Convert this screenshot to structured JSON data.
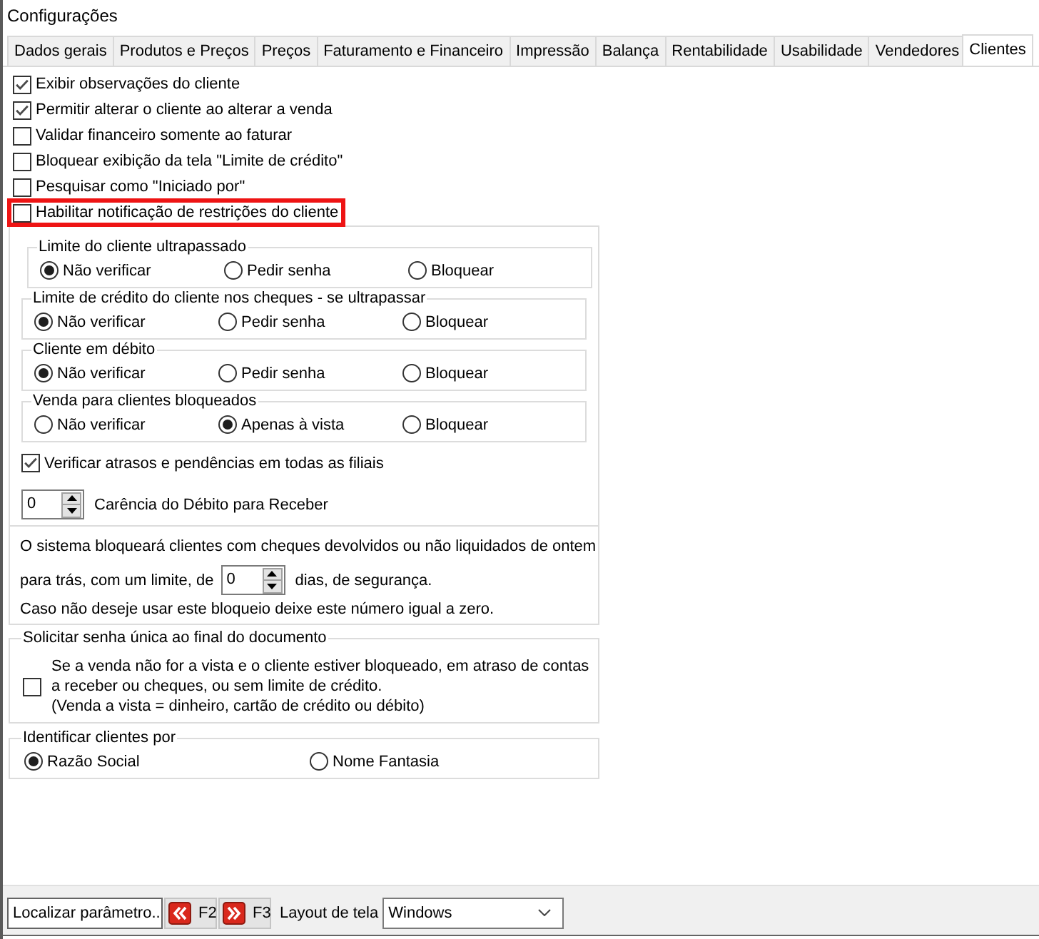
{
  "window": {
    "title": "Configurações"
  },
  "tabs": [
    {
      "label": "Dados gerais",
      "selected": false
    },
    {
      "label": "Produtos e Preços",
      "selected": false
    },
    {
      "label": "Preços",
      "selected": false
    },
    {
      "label": "Faturamento e Financeiro",
      "selected": false
    },
    {
      "label": "Impressão",
      "selected": false
    },
    {
      "label": "Balança",
      "selected": false
    },
    {
      "label": "Rentabilidade",
      "selected": false
    },
    {
      "label": "Usabilidade",
      "selected": false
    },
    {
      "label": "Vendedores",
      "selected": false
    },
    {
      "label": "Clientes",
      "selected": true
    }
  ],
  "options": [
    {
      "label": "Exibir observações do cliente",
      "checked": true,
      "highlighted": false
    },
    {
      "label": "Permitir alterar o cliente ao alterar a venda",
      "checked": true,
      "highlighted": false
    },
    {
      "label": "Validar financeiro somente ao faturar",
      "checked": false,
      "highlighted": false
    },
    {
      "label": "Bloquear exibição da tela \"Limite de crédito\"",
      "checked": false,
      "highlighted": false
    },
    {
      "label": "Pesquisar como \"Iniciado por\"",
      "checked": false,
      "highlighted": false
    },
    {
      "label": "Habilitar notificação de restrições do cliente",
      "checked": false,
      "highlighted": true
    }
  ],
  "restriction_groups": [
    {
      "title": "Limite do cliente ultrapassado",
      "choices": [
        {
          "label": "Não verificar",
          "selected": true
        },
        {
          "label": "Pedir senha",
          "selected": false
        },
        {
          "label": "Bloquear",
          "selected": false
        }
      ]
    },
    {
      "title": "Limite de crédito do cliente nos cheques - se ultrapassar",
      "choices": [
        {
          "label": "Não verificar",
          "selected": true
        },
        {
          "label": "Pedir senha",
          "selected": false
        },
        {
          "label": "Bloquear",
          "selected": false
        }
      ]
    },
    {
      "title": "Cliente em débito",
      "choices": [
        {
          "label": "Não verificar",
          "selected": true
        },
        {
          "label": "Pedir senha",
          "selected": false
        },
        {
          "label": "Bloquear",
          "selected": false
        }
      ]
    },
    {
      "title": "Venda para clientes bloqueados",
      "choices": [
        {
          "label": "Não verificar",
          "selected": false
        },
        {
          "label": "Apenas à vista",
          "selected": true
        },
        {
          "label": "Bloquear",
          "selected": false
        }
      ]
    }
  ],
  "check_all_branches": {
    "label": "Verificar atrasos e pendências em todas as filiais",
    "checked": true
  },
  "grace_period": {
    "value": "0",
    "label": "Carência do Débito para Receber"
  },
  "returned_cheques": {
    "line_1": "O sistema bloqueará clientes com cheques devolvidos ou não liquidados de ontem",
    "before_field": "para trás, com um limite, de",
    "days": "0",
    "after_field": "dias, de segurança.",
    "line_3": "Caso não deseje usar este bloqueio deixe este número igual a zero."
  },
  "single_password": {
    "title": "Solicitar senha única ao final do documento",
    "checked": false,
    "description": "Se a venda não for a vista e o cliente estiver bloqueado, em atraso de contas a receber ou cheques, ou sem limite de crédito.",
    "note": "(Venda a vista = dinheiro, cartão de crédito ou débito)"
  },
  "identify_clients": {
    "title": "Identificar clientes por",
    "choices": [
      {
        "label": "Razão Social",
        "selected": true
      },
      {
        "label": "Nome Fantasia",
        "selected": false
      }
    ]
  },
  "bottom_bar": {
    "search": {
      "value": "Localizar parâmetro.."
    },
    "nav_buttons": [
      {
        "kind": "previous",
        "label": "F2"
      },
      {
        "kind": "next",
        "label": "F3"
      }
    ],
    "layout": {
      "label": "Layout de tela",
      "value": "Windows"
    }
  }
}
